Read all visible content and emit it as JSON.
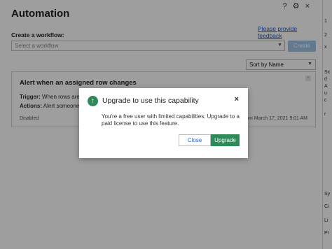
{
  "header": {
    "title": "Automation",
    "icons": [
      "help-icon",
      "gear-icon",
      "close-icon"
    ],
    "help_glyph": "?",
    "gear_glyph": "⚙",
    "close_glyph": "×",
    "feedback_link": "Please provide feedback"
  },
  "create": {
    "label": "Create a workflow:",
    "select_placeholder": "Select a workflow",
    "create_button": "Create"
  },
  "sort": {
    "selected": "Sort by Name"
  },
  "workflow_card": {
    "title": "Alert when an assigned row changes",
    "trigger_label": "Trigger:",
    "trigger_text": "When rows are a",
    "actions_label": "Actions:",
    "actions_text": "Alert someone",
    "status": "Disabled",
    "meta": "com  March 17, 2021 9:01 AM"
  },
  "modal": {
    "title": "Upgrade to use this capability",
    "body": "You're a free user with limited capabilities. Upgrade to a paid license to use this feature.",
    "close_button": "Close",
    "upgrade_button": "Upgrade",
    "icon": "upgrade-arrow-icon",
    "close_glyph": "×"
  },
  "right_strip": {
    "fragments": [
      "1",
      "2",
      "x",
      "Sx",
      "d",
      "A",
      "u",
      "c",
      "r",
      "Sy",
      "Ci",
      "Li",
      "Pr"
    ]
  },
  "colors": {
    "accent_green": "#2e8a57",
    "link_blue": "#1a5bd6",
    "create_disabled": "#9ec3e6"
  }
}
